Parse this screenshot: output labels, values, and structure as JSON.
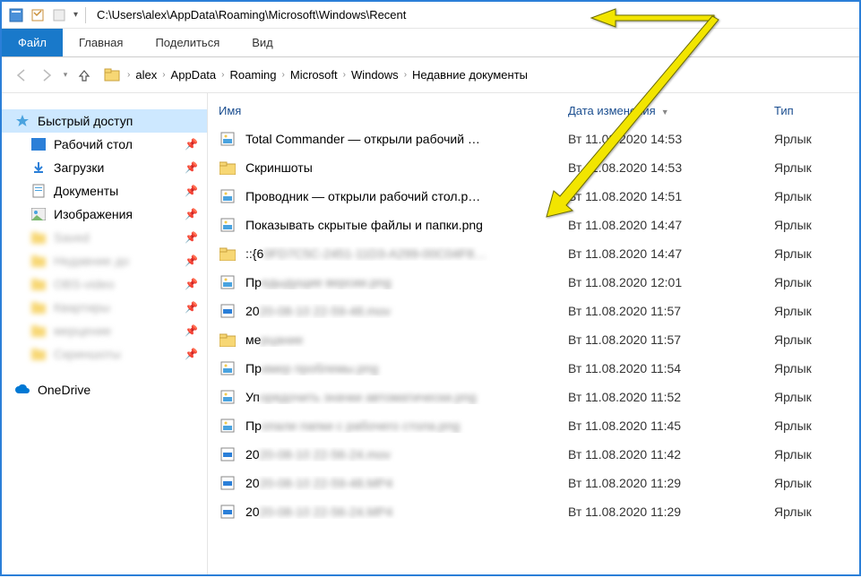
{
  "titlebar": {
    "path": "C:\\Users\\alex\\AppData\\Roaming\\Microsoft\\Windows\\Recent"
  },
  "ribbon": {
    "file": "Файл",
    "home": "Главная",
    "share": "Поделиться",
    "view": "Вид"
  },
  "breadcrumb": {
    "items": [
      "alex",
      "AppData",
      "Roaming",
      "Microsoft",
      "Windows",
      "Недавние документы"
    ]
  },
  "sidebar": {
    "quick_access": "Быстрый доступ",
    "desktop": "Рабочий стол",
    "downloads": "Загрузки",
    "documents": "Документы",
    "pictures": "Изображения",
    "blurred": [
      "Saved",
      "Недавние до",
      "OBS-video",
      "Квартиры",
      "мерцение",
      "Скриншоты"
    ],
    "onedrive": "OneDrive"
  },
  "columns": {
    "name": "Имя",
    "date": "Дата изменения",
    "type": "Тип"
  },
  "files": [
    {
      "icon": "img",
      "name": "Total Commander — открыли рабочий …",
      "date": "Вт 11.08.2020 14:53",
      "type": "Ярлык",
      "blur": false
    },
    {
      "icon": "folder",
      "name": "Скриншоты",
      "date": "Вт 11.08.2020 14:53",
      "type": "Ярлык",
      "blur": false
    },
    {
      "icon": "img",
      "name": "Проводник — открыли рабочий стол.p…",
      "date": "Вт 11.08.2020 14:51",
      "type": "Ярлык",
      "blur": false
    },
    {
      "icon": "img",
      "name": "Показывать скрытые файлы и папки.png",
      "date": "Вт 11.08.2020 14:47",
      "type": "Ярлык",
      "blur": false
    },
    {
      "icon": "folder",
      "name": "::{6",
      "tail": "0FD7C5C-2451-11D3-A299-00C04F8…",
      "date": "Вт 11.08.2020 14:47",
      "type": "Ярлык",
      "blur": true
    },
    {
      "icon": "img",
      "name": "Пр",
      "tail": "едыдущие версии.png",
      "date": "Вт 11.08.2020 12:01",
      "type": "Ярлык",
      "blur": true
    },
    {
      "icon": "vid",
      "name": "20",
      "tail": "20-08-10 22-59-48.mov",
      "date": "Вт 11.08.2020 11:57",
      "type": "Ярлык",
      "blur": true
    },
    {
      "icon": "folder",
      "name": "ме",
      "tail": "рцание",
      "date": "Вт 11.08.2020 11:57",
      "type": "Ярлык",
      "blur": true
    },
    {
      "icon": "img",
      "name": "Пр",
      "tail": "имер проблемы.png",
      "date": "Вт 11.08.2020 11:54",
      "type": "Ярлык",
      "blur": true
    },
    {
      "icon": "img",
      "name": "Уп",
      "tail": "орядочить значки автоматически.png",
      "date": "Вт 11.08.2020 11:52",
      "type": "Ярлык",
      "blur": true
    },
    {
      "icon": "img",
      "name": "Пр",
      "tail": "опали папки с рабочего стола.png",
      "date": "Вт 11.08.2020 11:45",
      "type": "Ярлык",
      "blur": true
    },
    {
      "icon": "vid",
      "name": "20",
      "tail": "20-08-10 22-56-24.mov",
      "date": "Вт 11.08.2020 11:42",
      "type": "Ярлык",
      "blur": true
    },
    {
      "icon": "vid",
      "name": "20",
      "tail": "20-08-10 22-59-48.MP4",
      "date": "Вт 11.08.2020 11:29",
      "type": "Ярлык",
      "blur": true
    },
    {
      "icon": "vid",
      "name": "20",
      "tail": "20-08-10 22-56-24.MP4",
      "date": "Вт 11.08.2020 11:29",
      "type": "Ярлык",
      "blur": true
    }
  ]
}
